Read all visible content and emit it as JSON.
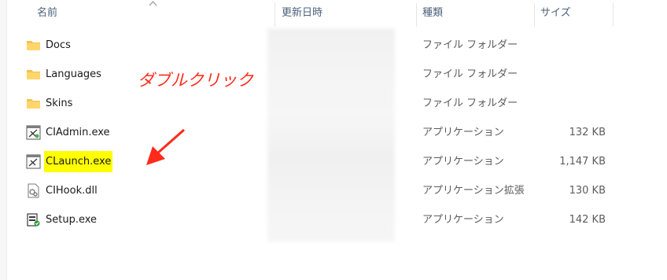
{
  "header": {
    "col_name": "名前",
    "col_date": "更新日時",
    "col_type": "種類",
    "col_size": "サイズ"
  },
  "files": [
    {
      "name": "Docs",
      "type": "ファイル フォルダー",
      "size": "",
      "icon": "folder-icon"
    },
    {
      "name": "Languages",
      "type": "ファイル フォルダー",
      "size": "",
      "icon": "folder-icon"
    },
    {
      "name": "Skins",
      "type": "ファイル フォルダー",
      "size": "",
      "icon": "folder-icon"
    },
    {
      "name": "CIAdmin.exe",
      "type": "アプリケーション",
      "size": "132 KB",
      "icon": "exe-icon"
    },
    {
      "name": "CLaunch.exe",
      "type": "アプリケーション",
      "size": "1,147 KB",
      "icon": "exe-icon"
    },
    {
      "name": "CIHook.dll",
      "type": "アプリケーション拡張",
      "size": "130 KB",
      "icon": "dll-icon"
    },
    {
      "name": "Setup.exe",
      "type": "アプリケーション",
      "size": "142 KB",
      "icon": "setup-icon"
    }
  ],
  "annotation": {
    "text": "ダブルクリック",
    "color": "#ff2a1a",
    "highlight_color": "#ffff00"
  }
}
